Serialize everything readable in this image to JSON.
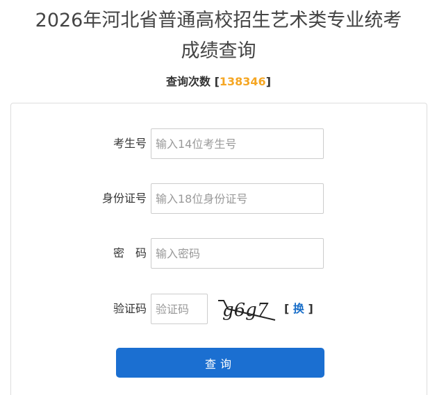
{
  "header": {
    "title_line1": "2026年河北省普通高校招生艺术类专业统考",
    "title_line2": "成绩查询"
  },
  "counter": {
    "label": "查询次数",
    "open": "[",
    "value": "138346",
    "close": "]"
  },
  "form": {
    "candidate_id": {
      "label": "考生号",
      "placeholder": "输入14位考生号",
      "value": ""
    },
    "id_card": {
      "label": "身份证号",
      "placeholder": "输入18位身份证号",
      "value": ""
    },
    "password": {
      "label": "密　码",
      "placeholder": "输入密码",
      "value": ""
    },
    "captcha": {
      "label": "验证码",
      "placeholder": "验证码",
      "value": "",
      "image_text": "g6g7",
      "refresh_open": "[",
      "refresh_label": "换",
      "refresh_close": "]"
    },
    "submit_label": "查询"
  },
  "colors": {
    "counter_number": "#f5a623",
    "button": "#1b6fd1",
    "refresh_link": "#1a6fc9"
  }
}
